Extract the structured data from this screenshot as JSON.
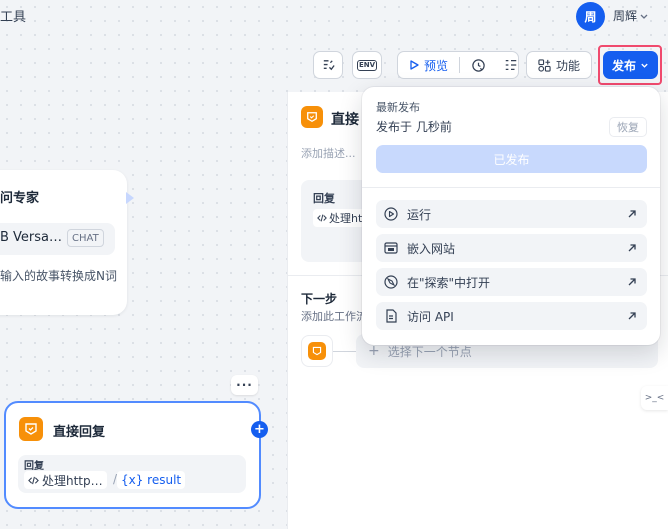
{
  "header": {
    "title_fragment": "工具",
    "avatar_initial": "周",
    "username": "周辉"
  },
  "toolbar": {
    "env_label": "ENV",
    "preview_label": "预览",
    "features_label": "功能",
    "publish_label": "发布"
  },
  "llm_node": {
    "title_fragment": "问专家",
    "model_fragment": "B Versa…",
    "model_badge": "CHAT",
    "description_fragment": "输入的故事转换成N词"
  },
  "reply_node": {
    "more_label": "···",
    "title": "直接回复",
    "box_label": "回复",
    "var_label": "处理http…",
    "separator": "/",
    "result_label": "{x} result",
    "add_label": "+"
  },
  "panel": {
    "title_fragment": "直接",
    "description_placeholder": "添加描述...",
    "reply_label": "回复",
    "reply_var": "处理ht",
    "next_step_title": "下一步",
    "next_step_desc": "添加此工作流",
    "select_next_placeholder": "选择下一个节点",
    "side_handle_label": ">_<"
  },
  "publish_menu": {
    "latest_label": "最新发布",
    "published_time": "发布于 几秒前",
    "restore_label": "恢复",
    "published_button": "已发布",
    "items": [
      {
        "label": "运行",
        "icon": "play-circle-icon"
      },
      {
        "label": "嵌入网站",
        "icon": "embed-window-icon"
      },
      {
        "label": "在\"探索\"中打开",
        "icon": "compass-icon"
      },
      {
        "label": "访问 API",
        "icon": "document-api-icon"
      }
    ]
  },
  "colors": {
    "primary": "#155eef",
    "node_orange": "#f79009",
    "highlight_red": "#f04a6e"
  }
}
